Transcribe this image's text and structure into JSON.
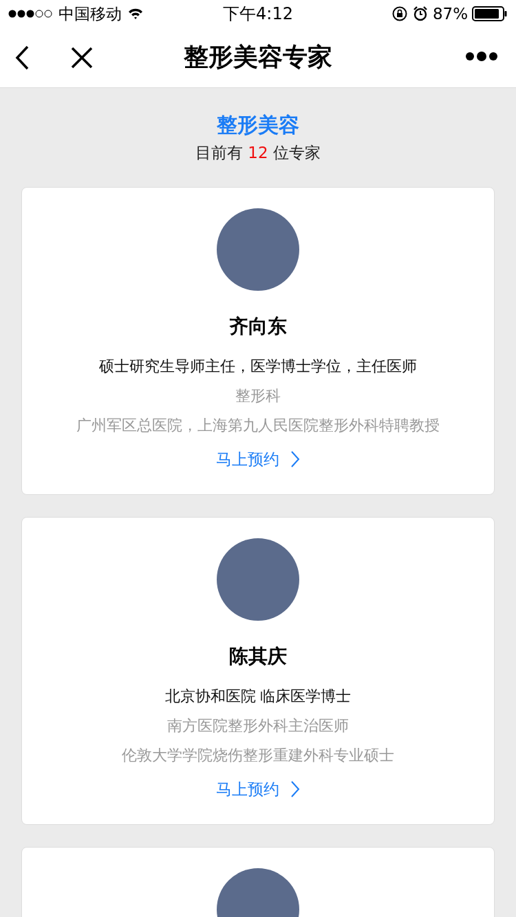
{
  "status_bar": {
    "carrier": "中国移动",
    "time": "下午4:12",
    "battery_text": "87%"
  },
  "nav": {
    "title": "整形美容专家"
  },
  "header": {
    "title": "整形美容",
    "count_prefix": "目前有",
    "count": "12",
    "count_suffix": "位专家"
  },
  "experts": [
    {
      "kind": "full",
      "name": "齐向东",
      "title": "硕士研究生导师主任，医学博士学位，主任医师",
      "department": "整形科",
      "description": "广州军区总医院，上海第九人民医院整形外科特聘教授",
      "action": "马上预约"
    },
    {
      "kind": "full",
      "name": "陈其庆",
      "title": "北京协和医院 临床医学博士",
      "department": "南方医院整形外科主治医师",
      "description": "伦敦大学学院烧伤整形重建外科专业硕士",
      "action": "马上预约"
    },
    {
      "kind": "avatar_only"
    }
  ]
}
